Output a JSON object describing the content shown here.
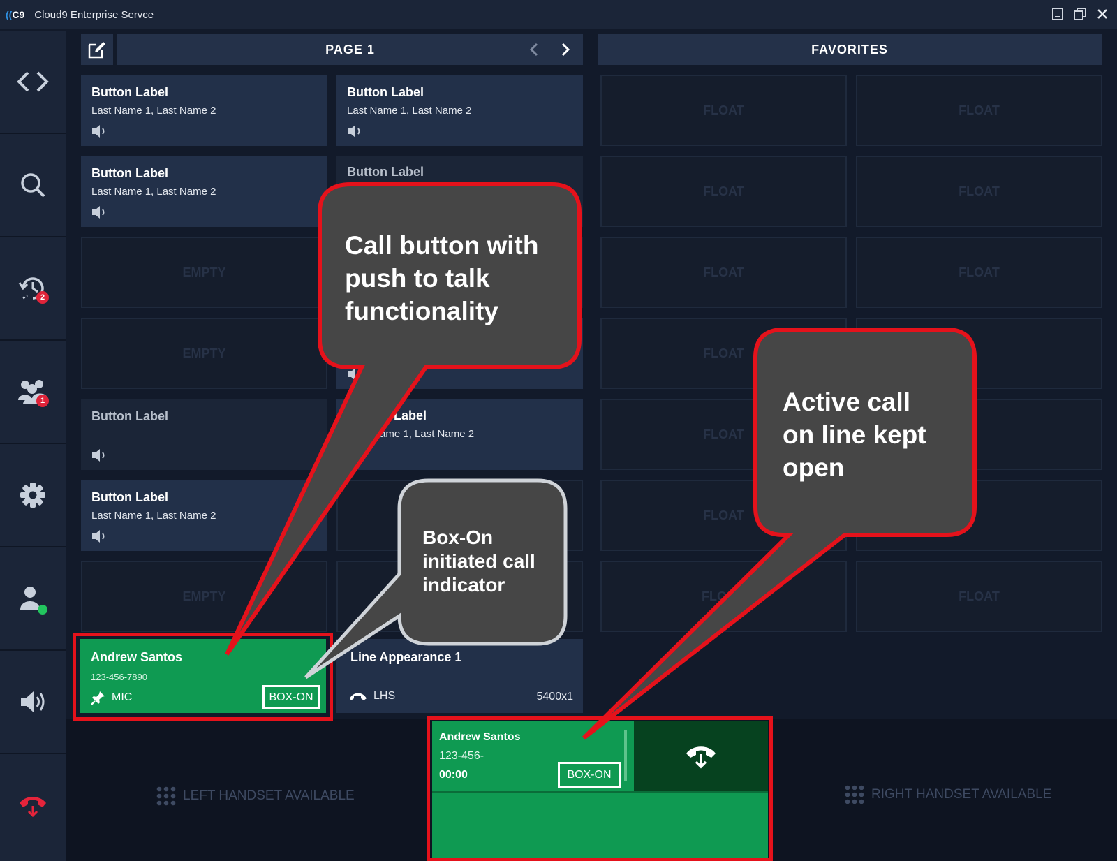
{
  "window": {
    "logo": "C9",
    "title": "Cloud9 Enterprise Servce"
  },
  "sidebar": {
    "items": [
      {
        "icon": "code-arrows-icon"
      },
      {
        "icon": "search-icon"
      },
      {
        "icon": "history-icon",
        "badge": "2"
      },
      {
        "icon": "contacts-icon",
        "badge": "1"
      },
      {
        "icon": "gear-icon"
      },
      {
        "icon": "user-presence-icon"
      },
      {
        "icon": "speaker-icon"
      },
      {
        "icon": "hangup-icon"
      }
    ]
  },
  "header": {
    "page_title": "PAGE 1",
    "favorites_title": "FAVORITES"
  },
  "grid": {
    "r1c1": {
      "label": "Button Label",
      "sub": "Last Name 1, Last Name 2"
    },
    "r1c2": {
      "label": "Button Label",
      "sub": "Last Name 1, Last Name 2"
    },
    "r2c1": {
      "label": "Button Label",
      "sub": "Last Name 1, Last Name 2"
    },
    "r2c2": {
      "label": "Button Label"
    },
    "r3c1": {
      "placeholder": "EMPTY"
    },
    "r4c1": {
      "placeholder": "EMPTY"
    },
    "r5c1": {
      "label": "Button Label"
    },
    "r5c2": {
      "label": "Label",
      "sub": "ame 1, Last Name 2"
    },
    "r6c1": {
      "label": "Button Label",
      "sub": "Last Name 1, Last Name 2"
    },
    "r7c1": {
      "placeholder": "EMPTY"
    }
  },
  "favorites": {
    "placeholder": "FLOAT",
    "partial_at": "AT",
    "partial_flo": "FLO"
  },
  "call_button": {
    "name": "Andrew Santos",
    "number": "123-456-7890",
    "mic_label": "MIC",
    "box_on": "BOX-ON"
  },
  "line_appearance": {
    "name": "Line Appearance 1",
    "handset": "LHS",
    "extension": "5400x1"
  },
  "handsets": {
    "left": "LEFT HANDSET AVAILABLE",
    "right": "RIGHT HANDSET AVAILABLE"
  },
  "active_call": {
    "name": "Andrew Santos",
    "number": "123-456-",
    "timer": "00:00",
    "box_on": "BOX-ON"
  },
  "callouts": {
    "ptt": [
      "Call button with",
      "push to talk",
      "functionality"
    ],
    "boxon": [
      "Box-On",
      "initiated call",
      "indicator"
    ],
    "active": [
      "Active call",
      "on line kept",
      "open"
    ]
  },
  "colors": {
    "green": "#0f9a52",
    "highlight": "#e5121b",
    "callout_bg": "#464646",
    "badge": "#e0243a"
  }
}
